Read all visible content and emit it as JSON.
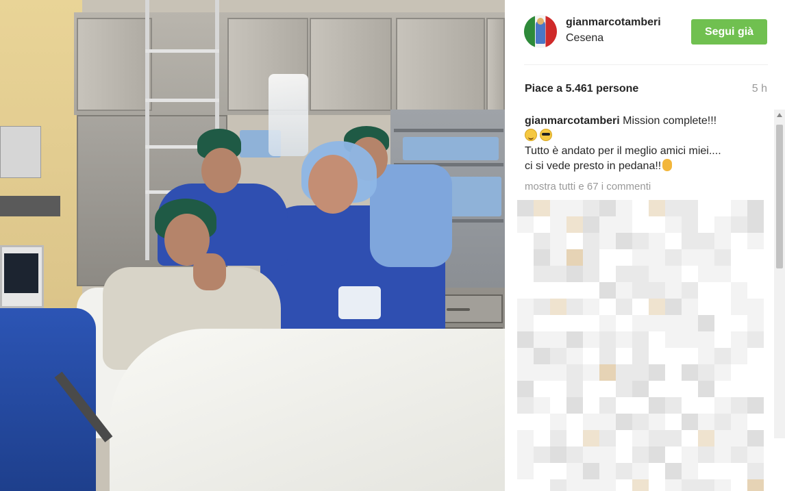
{
  "post": {
    "username": "gianmarcotamberi",
    "location": "Cesena",
    "follow_label": "Segui già",
    "likes": "Piace a 5.461 persone",
    "time_ago": "5 h",
    "caption_username": "gianmarcotamberi",
    "caption_line1": "Mission complete!!!",
    "caption_line2": "Tutto è andato per il meglio amici miei....",
    "caption_line3": "ci si vede presto in pedana!!",
    "view_all_comments": "mostra tutti e 67 i commenti"
  },
  "icons": {
    "emoji_1": "smiling-face-icon",
    "emoji_2": "sunglasses-face-icon",
    "emoji_3": "ok-hand-icon"
  },
  "colors": {
    "follow_button": "#70c050",
    "text": "#262626",
    "muted": "#999999"
  }
}
